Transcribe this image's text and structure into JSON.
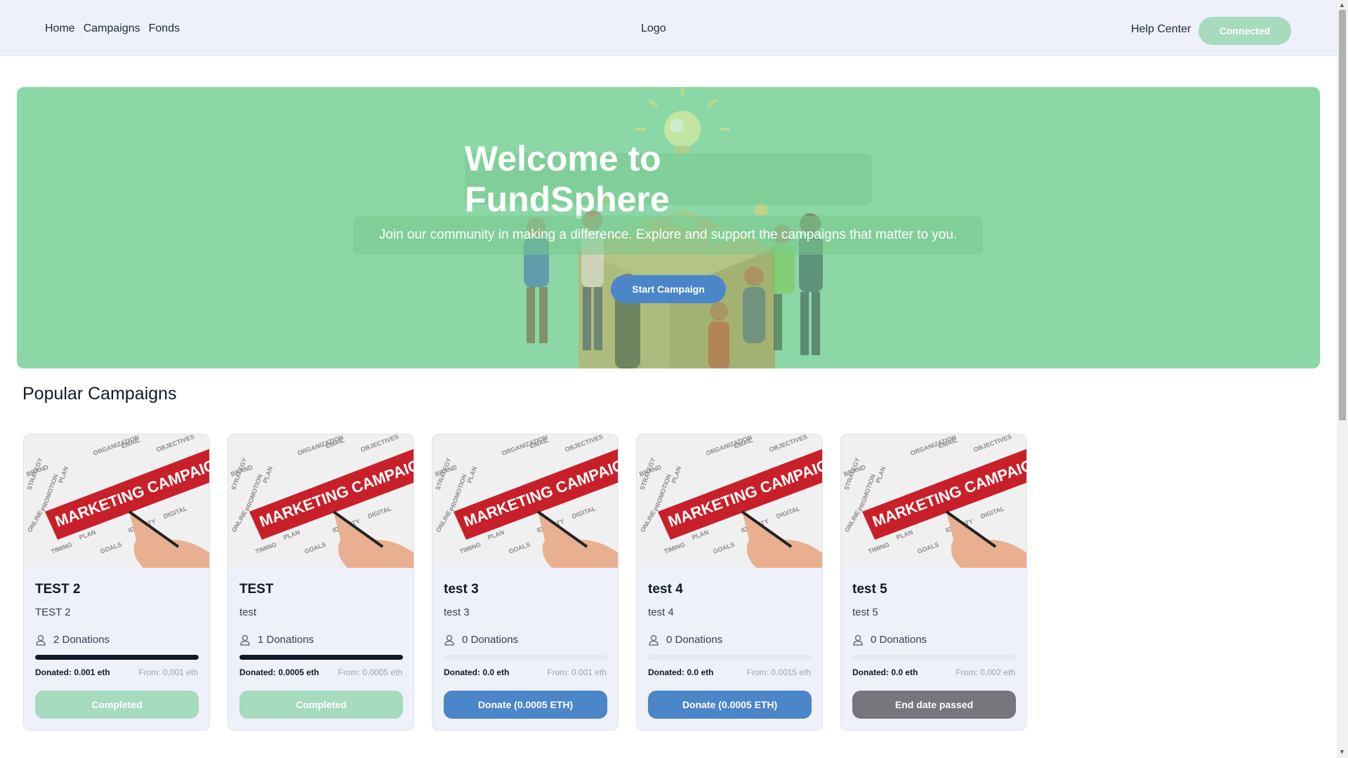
{
  "nav": {
    "links": [
      "Home",
      "Campaigns",
      "Fonds"
    ],
    "logo": "Logo",
    "help": "Help Center",
    "connect_label": "Connected"
  },
  "hero": {
    "title": "Welcome to FundSphere",
    "subtitle": "Join our community in making a difference. Explore and support the campaigns that matter to you.",
    "cta": "Start Campaign"
  },
  "section_title": "Popular Campaigns",
  "campaign_image_text": "MARKETING CAMPAIGN",
  "campaigns": [
    {
      "title": "TEST 2",
      "description": "TEST 2",
      "donations": "2 Donations",
      "progress": 1.0,
      "donated": "Donated: 0.001 eth",
      "from": "From: 0.001 eth",
      "button": "Completed",
      "status": "completed"
    },
    {
      "title": "TEST",
      "description": "test",
      "donations": "1 Donations",
      "progress": 1.0,
      "donated": "Donated: 0.0005 eth",
      "from": "From: 0.0005 eth",
      "button": "Completed",
      "status": "completed"
    },
    {
      "title": "test 3",
      "description": "test 3",
      "donations": "0 Donations",
      "progress": 0.0,
      "donated": "Donated: 0.0 eth",
      "from": "From: 0.001 eth",
      "button": "Donate (0.0005 ETH)",
      "status": "active"
    },
    {
      "title": "test 4",
      "description": "test 4",
      "donations": "0 Donations",
      "progress": 0.0,
      "donated": "Donated: 0.0 eth",
      "from": "From: 0.0015 eth",
      "button": "Donate (0.0005 ETH)",
      "status": "active"
    },
    {
      "title": "test 5",
      "description": "test 5",
      "donations": "0 Donations",
      "progress": 0.0,
      "donated": "Donated: 0.0 eth",
      "from": "From: 0.002 eth",
      "button": "End date passed",
      "status": "ended"
    }
  ],
  "colors": {
    "nav_bg": "#eef0fa",
    "hero_bg": "#8bd7a6",
    "completed": "#a6dbbd",
    "donate": "#4a86c8",
    "ended": "#76767c"
  }
}
